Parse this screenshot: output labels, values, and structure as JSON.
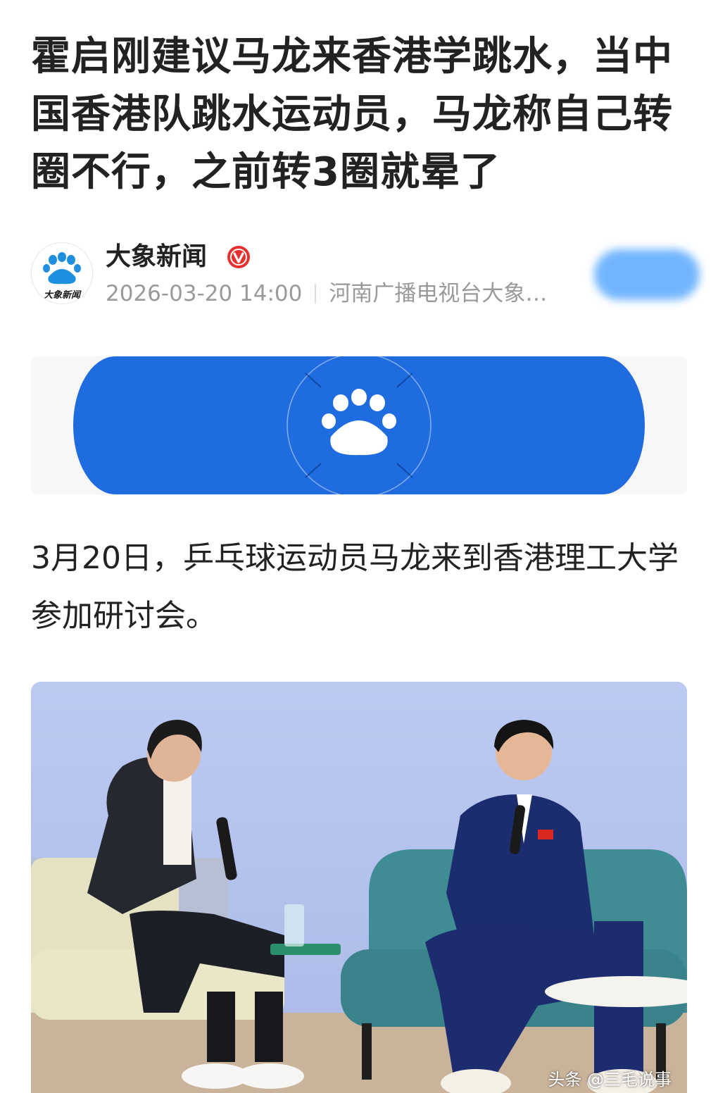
{
  "article": {
    "title": "霍启刚建议马龙来香港学跳水，当中国香港队跳水运动员，马龙称自己转圈不行，之前转3圈就晕了",
    "body": "3月20日，乒乓球运动员马龙来到香港理工大学参加研讨会。"
  },
  "author": {
    "name": "大象新闻",
    "avatar_text": "大象新闻",
    "avatar_icon": "paw-logo-icon",
    "verified_icon": "verified-badge-icon",
    "date": "2026-03-20 14:00",
    "source": "河南广播电视台大象…"
  },
  "banner": {
    "icon": "paw-logo-icon",
    "color": "#1f6be0"
  },
  "photo": {
    "watermark": "头条 @三毛说事",
    "background_color": "#b9c6ef"
  },
  "colors": {
    "brand_blue": "#1f6be0",
    "title_text": "#222222",
    "meta_text": "#9a9a9a",
    "verified_red": "#e8312f"
  }
}
